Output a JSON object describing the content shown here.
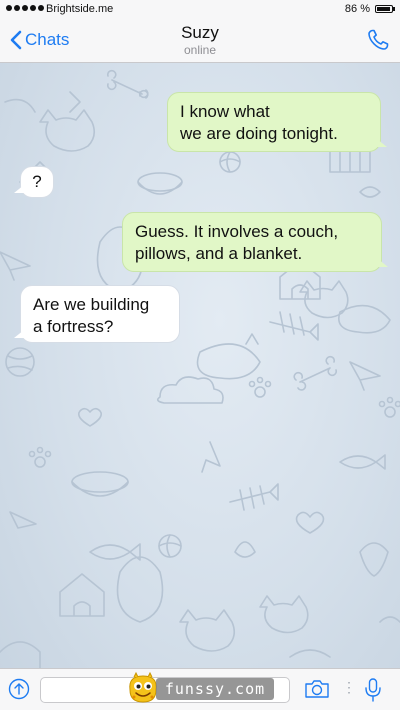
{
  "status_bar": {
    "carrier": "Brightside.me",
    "battery": "86 %"
  },
  "nav": {
    "back_label": "Chats",
    "contact_name": "Suzy",
    "contact_status": "online"
  },
  "messages": [
    {
      "direction": "outgoing",
      "lines": [
        "I know what",
        "we are doing tonight."
      ]
    },
    {
      "direction": "incoming",
      "lines": [
        "?"
      ]
    },
    {
      "direction": "outgoing",
      "lines": [
        "Guess. It involves a couch,",
        "pillows, and a blanket."
      ]
    },
    {
      "direction": "incoming",
      "lines": [
        "Are we building",
        "a fortress?"
      ]
    }
  ],
  "input_bar": {
    "placeholder": "",
    "icons": [
      "attach-icon",
      "camera-icon",
      "microphone-icon"
    ]
  },
  "watermark": {
    "text": "funssy.com"
  },
  "colors": {
    "accent": "#1e7cf2",
    "outgoing_bubble": "#e1f7c7",
    "incoming_bubble": "#ffffff",
    "chat_background": "#d4dfea"
  }
}
